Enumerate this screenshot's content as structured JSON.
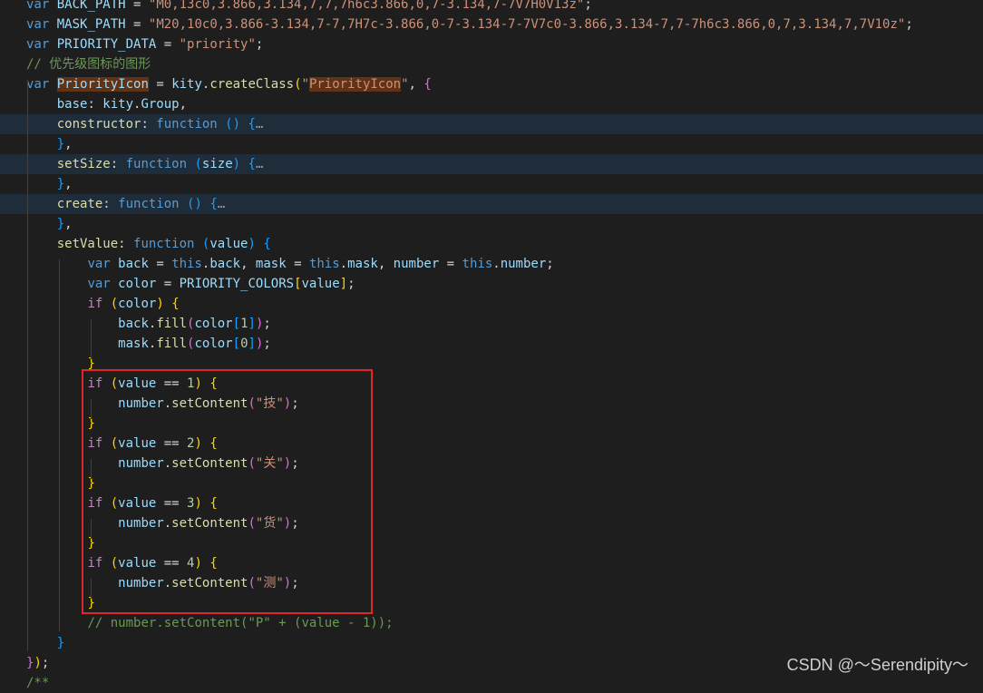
{
  "editor": {
    "lines": [
      [
        [
          "kw",
          "var"
        ],
        [
          "plain",
          " "
        ],
        [
          "var",
          "BACK_PATH"
        ],
        [
          "plain",
          " = "
        ],
        [
          "str",
          "\"M0,13c0,3.866,3.134,7,7,7h6c3.866,0,7-3.134,7-7V7H0V13z\""
        ],
        [
          "plain",
          ";"
        ]
      ],
      [
        [
          "kw",
          "var"
        ],
        [
          "plain",
          " "
        ],
        [
          "var",
          "MASK_PATH"
        ],
        [
          "plain",
          " = "
        ],
        [
          "str",
          "\"M20,10c0,3.866-3.134,7-7,7H7c-3.866,0-7-3.134-7-7V7c0-3.866,3.134-7,7-7h6c3.866,0,7,3.134,7,7V10z\""
        ],
        [
          "plain",
          ";"
        ]
      ],
      [
        [
          "kw",
          "var"
        ],
        [
          "plain",
          " "
        ],
        [
          "var",
          "PRIORITY_DATA"
        ],
        [
          "plain",
          " = "
        ],
        [
          "str",
          "\"priority\""
        ],
        [
          "plain",
          ";"
        ]
      ],
      [
        [
          "cmt",
          "// 优先级图标的图形"
        ]
      ],
      [
        [
          "kw",
          "var"
        ],
        [
          "plain",
          " "
        ],
        [
          "clsname",
          "PriorityIcon"
        ],
        [
          "plain",
          " = "
        ],
        [
          "var",
          "kity"
        ],
        [
          "plain",
          "."
        ],
        [
          "fn",
          "createClass"
        ],
        [
          "p1",
          "("
        ],
        [
          "str",
          "\""
        ],
        [
          "cls",
          "PriorityIcon"
        ],
        [
          "str",
          "\""
        ],
        [
          "plain",
          ", "
        ],
        [
          "p2",
          "{"
        ]
      ],
      [
        [
          "plain",
          "    "
        ],
        [
          "var",
          "base"
        ],
        [
          "plain",
          ": "
        ],
        [
          "var",
          "kity"
        ],
        [
          "plain",
          "."
        ],
        [
          "var",
          "Group"
        ],
        [
          "plain",
          ","
        ]
      ],
      [
        [
          "plain",
          "    "
        ],
        [
          "fn",
          "constructor"
        ],
        [
          "plain",
          ": "
        ],
        [
          "kw",
          "function"
        ],
        [
          "plain",
          " "
        ],
        [
          "p3",
          "()"
        ],
        [
          "plain",
          " "
        ],
        [
          "p3",
          "{"
        ],
        [
          "fold",
          "…"
        ]
      ],
      [
        [
          "plain",
          "    "
        ],
        [
          "p3",
          "}"
        ],
        [
          "plain",
          ","
        ]
      ],
      [
        [
          "plain",
          "    "
        ],
        [
          "fn",
          "setSize"
        ],
        [
          "plain",
          ": "
        ],
        [
          "kw",
          "function"
        ],
        [
          "plain",
          " "
        ],
        [
          "p3",
          "("
        ],
        [
          "var",
          "size"
        ],
        [
          "p3",
          ")"
        ],
        [
          "plain",
          " "
        ],
        [
          "p3",
          "{"
        ],
        [
          "fold",
          "…"
        ]
      ],
      [
        [
          "plain",
          "    "
        ],
        [
          "p3",
          "}"
        ],
        [
          "plain",
          ","
        ]
      ],
      [
        [
          "plain",
          "    "
        ],
        [
          "fn",
          "create"
        ],
        [
          "plain",
          ": "
        ],
        [
          "kw",
          "function"
        ],
        [
          "plain",
          " "
        ],
        [
          "p3",
          "()"
        ],
        [
          "plain",
          " "
        ],
        [
          "p3",
          "{"
        ],
        [
          "fold",
          "…"
        ]
      ],
      [
        [
          "plain",
          "    "
        ],
        [
          "p3",
          "}"
        ],
        [
          "plain",
          ","
        ]
      ],
      [
        [
          "plain",
          "    "
        ],
        [
          "fn",
          "setValue"
        ],
        [
          "plain",
          ": "
        ],
        [
          "kw",
          "function"
        ],
        [
          "plain",
          " "
        ],
        [
          "p3",
          "("
        ],
        [
          "var",
          "value"
        ],
        [
          "p3",
          ")"
        ],
        [
          "plain",
          " "
        ],
        [
          "p3",
          "{"
        ]
      ],
      [
        [
          "plain",
          "        "
        ],
        [
          "kw",
          "var"
        ],
        [
          "plain",
          " "
        ],
        [
          "var",
          "back"
        ],
        [
          "plain",
          " = "
        ],
        [
          "kw",
          "this"
        ],
        [
          "plain",
          "."
        ],
        [
          "var",
          "back"
        ],
        [
          "plain",
          ", "
        ],
        [
          "var",
          "mask"
        ],
        [
          "plain",
          " = "
        ],
        [
          "kw",
          "this"
        ],
        [
          "plain",
          "."
        ],
        [
          "var",
          "mask"
        ],
        [
          "plain",
          ", "
        ],
        [
          "var",
          "number"
        ],
        [
          "plain",
          " = "
        ],
        [
          "kw",
          "this"
        ],
        [
          "plain",
          "."
        ],
        [
          "var",
          "number"
        ],
        [
          "plain",
          ";"
        ]
      ],
      [
        [
          "plain",
          "        "
        ],
        [
          "kw",
          "var"
        ],
        [
          "plain",
          " "
        ],
        [
          "var",
          "color"
        ],
        [
          "plain",
          " = "
        ],
        [
          "var",
          "PRIORITY_COLORS"
        ],
        [
          "p1",
          "["
        ],
        [
          "var",
          "value"
        ],
        [
          "p1",
          "]"
        ],
        [
          "plain",
          ";"
        ]
      ],
      [
        [
          "plain",
          "        "
        ],
        [
          "ctrl",
          "if"
        ],
        [
          "plain",
          " "
        ],
        [
          "p1",
          "("
        ],
        [
          "var",
          "color"
        ],
        [
          "p1",
          ")"
        ],
        [
          "plain",
          " "
        ],
        [
          "p1",
          "{"
        ]
      ],
      [
        [
          "plain",
          "            "
        ],
        [
          "var",
          "back"
        ],
        [
          "plain",
          "."
        ],
        [
          "fn",
          "fill"
        ],
        [
          "p2",
          "("
        ],
        [
          "var",
          "color"
        ],
        [
          "p3",
          "["
        ],
        [
          "num",
          "1"
        ],
        [
          "p3",
          "]"
        ],
        [
          "p2",
          ")"
        ],
        [
          "plain",
          ";"
        ]
      ],
      [
        [
          "plain",
          "            "
        ],
        [
          "var",
          "mask"
        ],
        [
          "plain",
          "."
        ],
        [
          "fn",
          "fill"
        ],
        [
          "p2",
          "("
        ],
        [
          "var",
          "color"
        ],
        [
          "p3",
          "["
        ],
        [
          "num",
          "0"
        ],
        [
          "p3",
          "]"
        ],
        [
          "p2",
          ")"
        ],
        [
          "plain",
          ";"
        ]
      ],
      [
        [
          "plain",
          "        "
        ],
        [
          "p1",
          "}"
        ]
      ],
      [
        [
          "plain",
          "        "
        ],
        [
          "ctrl",
          "if"
        ],
        [
          "plain",
          " "
        ],
        [
          "p1",
          "("
        ],
        [
          "var",
          "value"
        ],
        [
          "plain",
          " == "
        ],
        [
          "num",
          "1"
        ],
        [
          "p1",
          ")"
        ],
        [
          "plain",
          " "
        ],
        [
          "p1",
          "{"
        ]
      ],
      [
        [
          "plain",
          "            "
        ],
        [
          "var",
          "number"
        ],
        [
          "plain",
          "."
        ],
        [
          "fn",
          "setContent"
        ],
        [
          "p2",
          "("
        ],
        [
          "str",
          "\"技\""
        ],
        [
          "p2",
          ")"
        ],
        [
          "plain",
          ";"
        ]
      ],
      [
        [
          "plain",
          "        "
        ],
        [
          "p1",
          "}"
        ]
      ],
      [
        [
          "plain",
          "        "
        ],
        [
          "ctrl",
          "if"
        ],
        [
          "plain",
          " "
        ],
        [
          "p1",
          "("
        ],
        [
          "var",
          "value"
        ],
        [
          "plain",
          " == "
        ],
        [
          "num",
          "2"
        ],
        [
          "p1",
          ")"
        ],
        [
          "plain",
          " "
        ],
        [
          "p1",
          "{"
        ]
      ],
      [
        [
          "plain",
          "            "
        ],
        [
          "var",
          "number"
        ],
        [
          "plain",
          "."
        ],
        [
          "fn",
          "setContent"
        ],
        [
          "p2",
          "("
        ],
        [
          "str",
          "\"关\""
        ],
        [
          "p2",
          ")"
        ],
        [
          "plain",
          ";"
        ]
      ],
      [
        [
          "plain",
          "        "
        ],
        [
          "p1",
          "}"
        ]
      ],
      [
        [
          "plain",
          "        "
        ],
        [
          "ctrl",
          "if"
        ],
        [
          "plain",
          " "
        ],
        [
          "p1",
          "("
        ],
        [
          "var",
          "value"
        ],
        [
          "plain",
          " == "
        ],
        [
          "num",
          "3"
        ],
        [
          "p1",
          ")"
        ],
        [
          "plain",
          " "
        ],
        [
          "p1",
          "{"
        ]
      ],
      [
        [
          "plain",
          "            "
        ],
        [
          "var",
          "number"
        ],
        [
          "plain",
          "."
        ],
        [
          "fn",
          "setContent"
        ],
        [
          "p2",
          "("
        ],
        [
          "str",
          "\"货\""
        ],
        [
          "p2",
          ")"
        ],
        [
          "plain",
          ";"
        ]
      ],
      [
        [
          "plain",
          "        "
        ],
        [
          "p1",
          "}"
        ]
      ],
      [
        [
          "plain",
          "        "
        ],
        [
          "ctrl",
          "if"
        ],
        [
          "plain",
          " "
        ],
        [
          "p1",
          "("
        ],
        [
          "var",
          "value"
        ],
        [
          "plain",
          " == "
        ],
        [
          "num",
          "4"
        ],
        [
          "p1",
          ")"
        ],
        [
          "plain",
          " "
        ],
        [
          "p1",
          "{"
        ]
      ],
      [
        [
          "plain",
          "            "
        ],
        [
          "var",
          "number"
        ],
        [
          "plain",
          "."
        ],
        [
          "fn",
          "setContent"
        ],
        [
          "p2",
          "("
        ],
        [
          "str",
          "\"测\""
        ],
        [
          "p2",
          ")"
        ],
        [
          "plain",
          ";"
        ]
      ],
      [
        [
          "plain",
          "        "
        ],
        [
          "p1",
          "}"
        ]
      ],
      [
        [
          "plain",
          "        "
        ],
        [
          "cmt",
          "// number.setContent(\"P\" + (value - 1));"
        ]
      ],
      [
        [
          "plain",
          "    "
        ],
        [
          "p3",
          "}"
        ]
      ],
      [
        [
          "p2",
          "}"
        ],
        [
          "p1",
          ")"
        ],
        [
          "plain",
          ";"
        ]
      ],
      [
        [
          "cmt",
          "/**"
        ]
      ]
    ],
    "highlighted_lines": [
      6,
      8,
      10
    ]
  },
  "watermark": "CSDN @～Serendipity～"
}
